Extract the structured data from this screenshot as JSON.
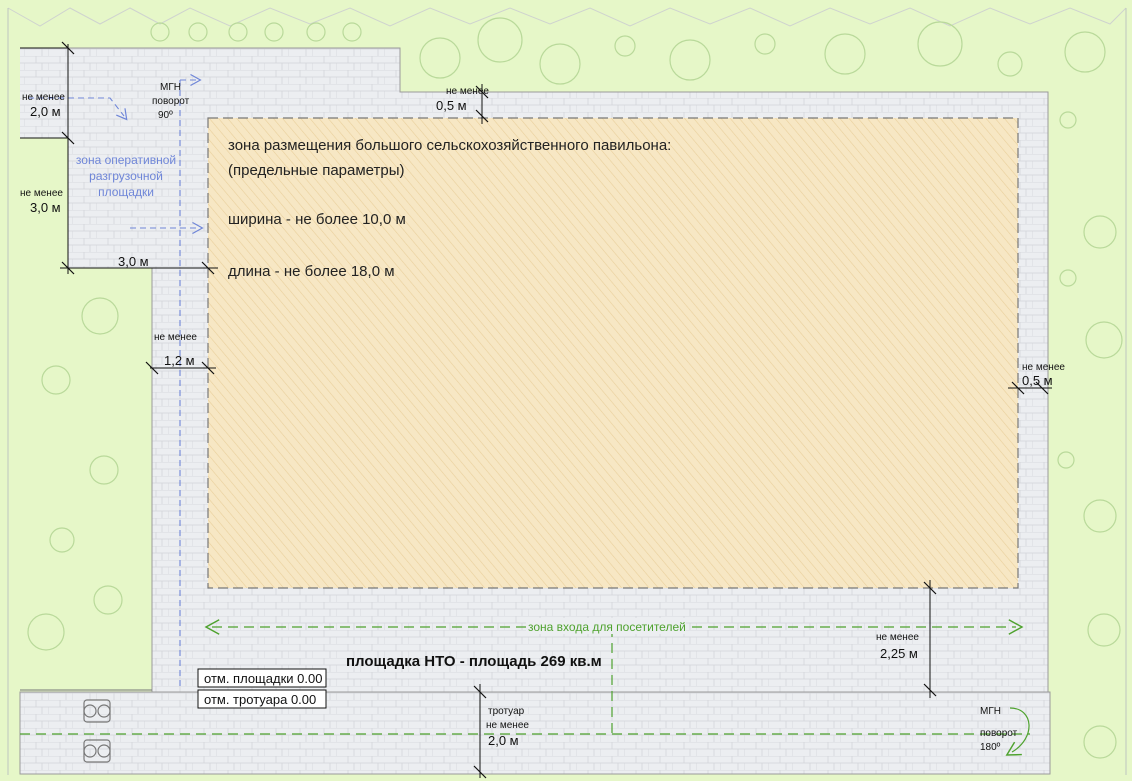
{
  "pavilion": {
    "title": "зона размещения большого сельскохозяйственного павильона:",
    "subtitle": "(предельные параметры)",
    "width": "ширина - не более 10,0 м",
    "length": "длина - не более 18,0 м"
  },
  "site_area": "площадка НТО - площадь 269 кв.м",
  "elevation_site": "отм. площадки 0.00",
  "elevation_sidewalk": "отм. тротуара 0.00",
  "unloading_zone": [
    "зона оперативной",
    "разгрузочной",
    "площадки"
  ],
  "entrance_zone": "зона входа для посетителей",
  "mgn_top": [
    "МГН",
    "поворот",
    "90º"
  ],
  "mgn_bottom": [
    "МГН",
    "поворот",
    "180º"
  ],
  "dims": {
    "not_less": "не менее",
    "top_left": "2,0 м",
    "left_mid": "3,0 м",
    "horiz_3": "3,0 м",
    "gap_left": "1,2 м",
    "top_gap": "0,5 м",
    "right_gap": "0,5 м",
    "bottom_gap": "2,25 м",
    "sidewalk_label": "тротуар",
    "sidewalk": "2,0 м"
  },
  "colors": {
    "lawn": "#e6f7c8",
    "paving": "#eceef1",
    "pavilion_fill": "#f7e7c4",
    "blue_route": "#6f86d8",
    "green_route": "#4ea22e"
  }
}
